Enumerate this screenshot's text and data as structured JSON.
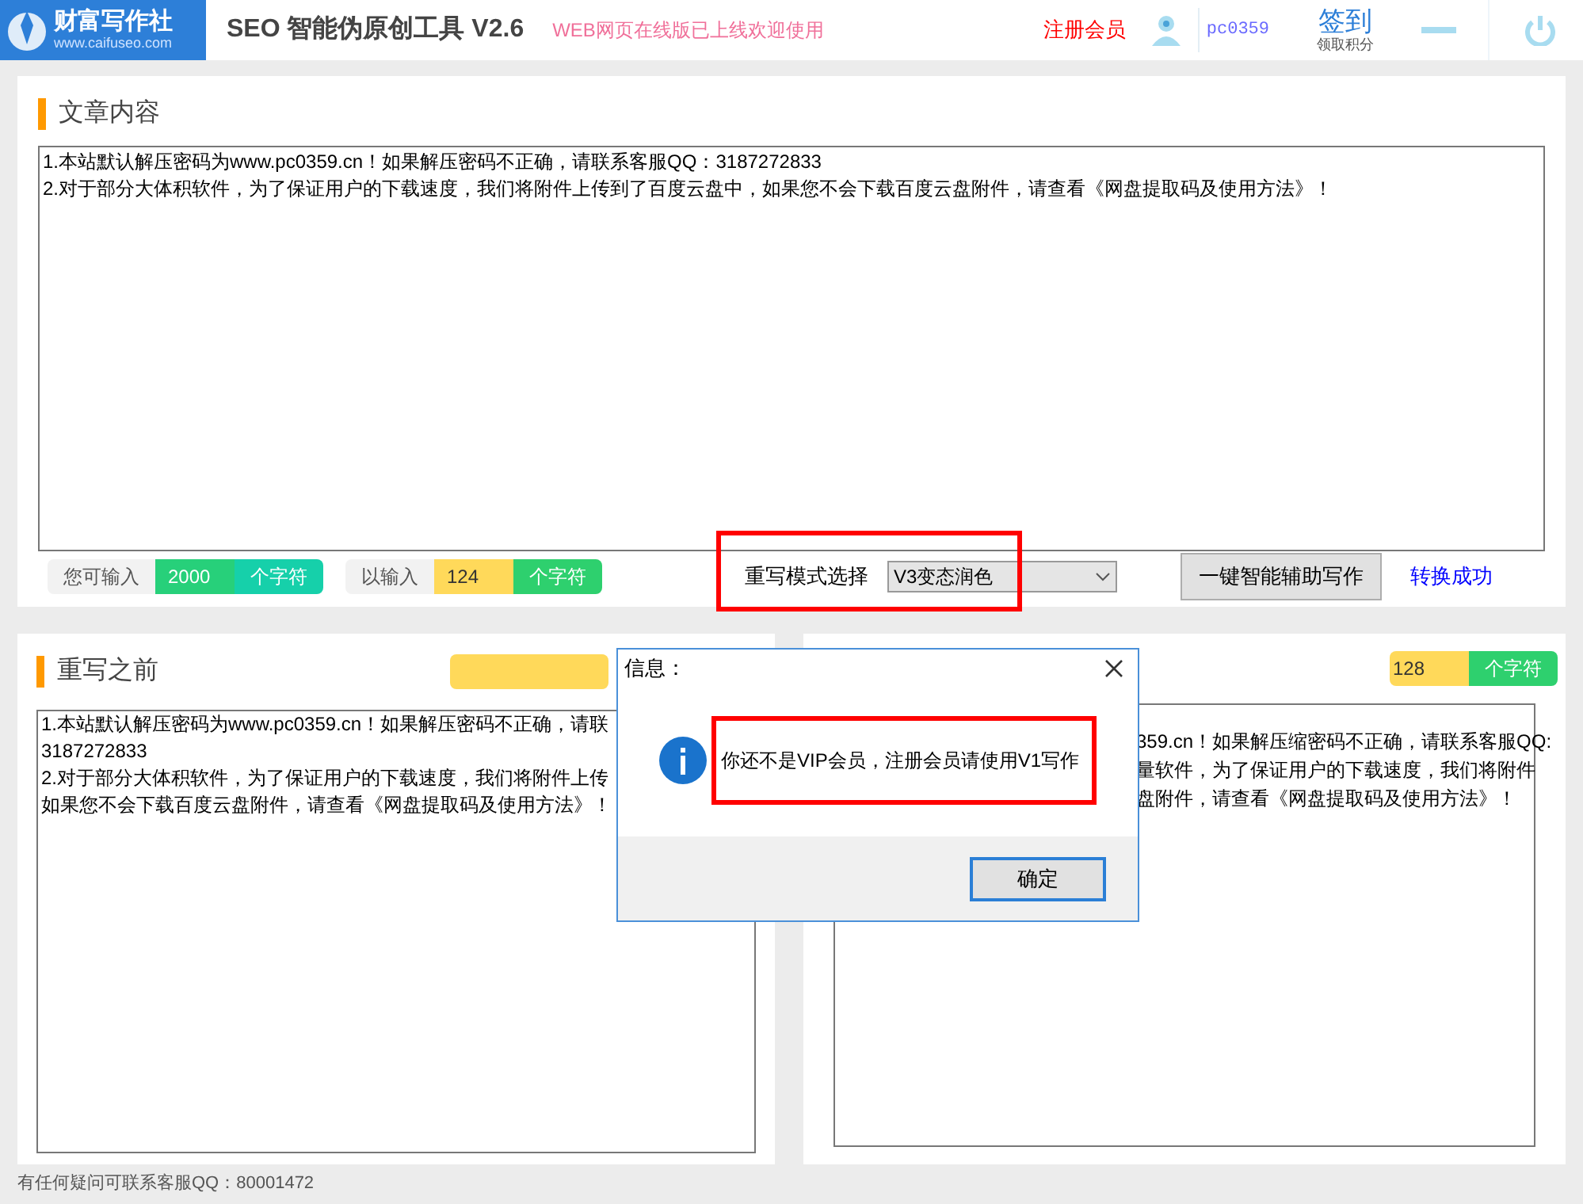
{
  "header": {
    "logo": {
      "name": "财富写作社",
      "url": "www.caifuseo.com"
    },
    "app_title": "SEO 智能伪原创工具 V2.6",
    "notice": "WEB网页在线版已上线欢迎使用",
    "register_link": "注册会员",
    "username": "pc0359",
    "checkin": {
      "label": "签到",
      "sublabel": "领取积分"
    }
  },
  "article": {
    "title": "文章内容",
    "lines": [
      "1.本站默认解压密码为www.pc0359.cn！如果解压密码不正确，请联系客服QQ：3187272833",
      "2.对于部分大体积软件，为了保证用户的下载速度，我们将附件上传到了百度云盘中，如果您不会下载百度云盘附件，请查看《网盘提取码及使用方法》！"
    ],
    "stats": [
      {
        "label": "您可输入",
        "value": "2000",
        "unit": "个字符",
        "color": "#27d07a"
      },
      {
        "label": "以输入",
        "value": "124",
        "unit": "个字符",
        "color": "#ffd95a"
      }
    ],
    "mode": {
      "label": "重写模式选择",
      "value": "V3变态润色"
    },
    "write_button": "一键智能辅助写作",
    "status": "转换成功"
  },
  "before": {
    "title": "重写之前",
    "lines": [
      "1.本站默认解压密码为www.pc0359.cn！如果解压密码不正确，请联",
      "3187272833",
      "2.对于部分大体积软件，为了保证用户的下载速度，我们将附件上传",
      "如果您不会下载百度云盘附件，请查看《网盘提取码及使用方法》！"
    ]
  },
  "after": {
    "count": {
      "value": "128",
      "unit": "个字符"
    },
    "lines": [
      "359.cn！如果解压缩密码不正确，请联系客服QQ:",
      "量软件，为了保证用户的下载速度，我们将附件",
      "盘附件，请查看《网盘提取码及使用方法》！"
    ]
  },
  "dialog": {
    "title": "信息：",
    "message": "你还不是VIP会员，注册会员请使用V1写作",
    "ok_button": "确定"
  },
  "footer": "有任何疑问可联系客服QQ：80001472"
}
